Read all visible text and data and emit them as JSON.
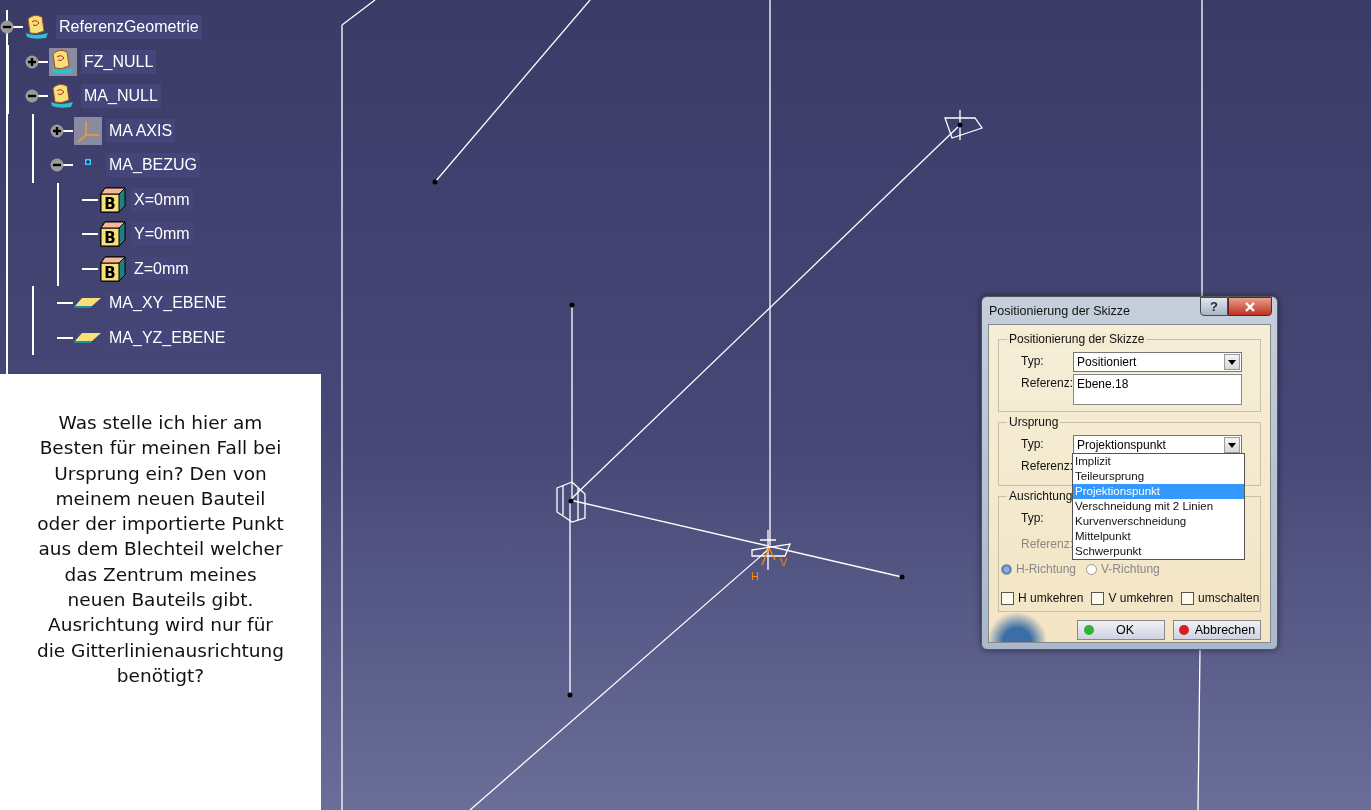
{
  "tree": [
    {
      "label": "ReferenzGeometrie",
      "kind": "geoset",
      "expanded": true,
      "children": [
        {
          "label": "FZ_NULL",
          "kind": "hidden-geoset",
          "expanded": false
        },
        {
          "label": "MA_NULL",
          "kind": "geoset",
          "expanded": true,
          "children": [
            {
              "label": "MA AXIS",
              "kind": "axis",
              "expanded": false
            },
            {
              "label": "MA_BEZUG",
              "kind": "point",
              "expanded": true,
              "children": [
                {
                  "label": "X=0mm",
                  "kind": "param",
                  "badge": "B"
                },
                {
                  "label": "Y=0mm",
                  "kind": "param",
                  "badge": "B"
                },
                {
                  "label": "Z=0mm",
                  "kind": "param",
                  "badge": "B"
                }
              ]
            },
            {
              "label": "MA_XY_EBENE",
              "kind": "plane"
            },
            {
              "label": "MA_YZ_EBENE",
              "kind": "plane"
            }
          ]
        }
      ]
    }
  ],
  "viewport": {
    "axis_labels": [
      "H",
      "V"
    ]
  },
  "note": {
    "text": "Was stelle ich hier am Besten für meinen Fall bei Ursprung ein? Den von meinem neuen Bauteil oder der importierte Punkt aus dem Blechteil welcher das Zentrum meines neuen Bauteils gibt. Ausrichtung wird nur für die Gitterlinienausrichtung benötigt?"
  },
  "dialog": {
    "title": "Positionierung der Skizze",
    "help": "?",
    "position_group": {
      "title": "Positionierung der Skizze",
      "type_label": "Typ:",
      "type_value": "Positioniert",
      "ref_label": "Referenz:",
      "ref_value": "Ebene.18"
    },
    "origin_group": {
      "title": "Ursprung",
      "type_label": "Typ:",
      "type_value": "Projektionspunkt",
      "ref_label": "Referenz:",
      "options": [
        {
          "label": "Implizit",
          "selected": false
        },
        {
          "label": "Teileursprung",
          "selected": false
        },
        {
          "label": "Projektionspunkt",
          "selected": true
        },
        {
          "label": "Verschneidung mit 2 Linien",
          "selected": false
        },
        {
          "label": "Kurvenverschneidung",
          "selected": false
        },
        {
          "label": "Mittelpunkt",
          "selected": false
        },
        {
          "label": "Schwerpunkt",
          "selected": false
        }
      ]
    },
    "orientation_group": {
      "title": "Ausrichtung",
      "type_label": "Typ:",
      "ref_label": "Referenz:",
      "ref_disabled": true,
      "radios": [
        {
          "label": "H-Richtung",
          "selected": true,
          "disabled": true
        },
        {
          "label": "V-Richtung",
          "selected": false,
          "disabled": true
        }
      ],
      "checkboxes": [
        {
          "label": "H umkehren",
          "checked": false
        },
        {
          "label": "V umkehren",
          "checked": false
        },
        {
          "label": "umschalten",
          "checked": false
        }
      ]
    },
    "buttons": [
      {
        "label": "OK",
        "kind": "ok"
      },
      {
        "label": "Abbrechen",
        "kind": "cancel"
      }
    ]
  }
}
